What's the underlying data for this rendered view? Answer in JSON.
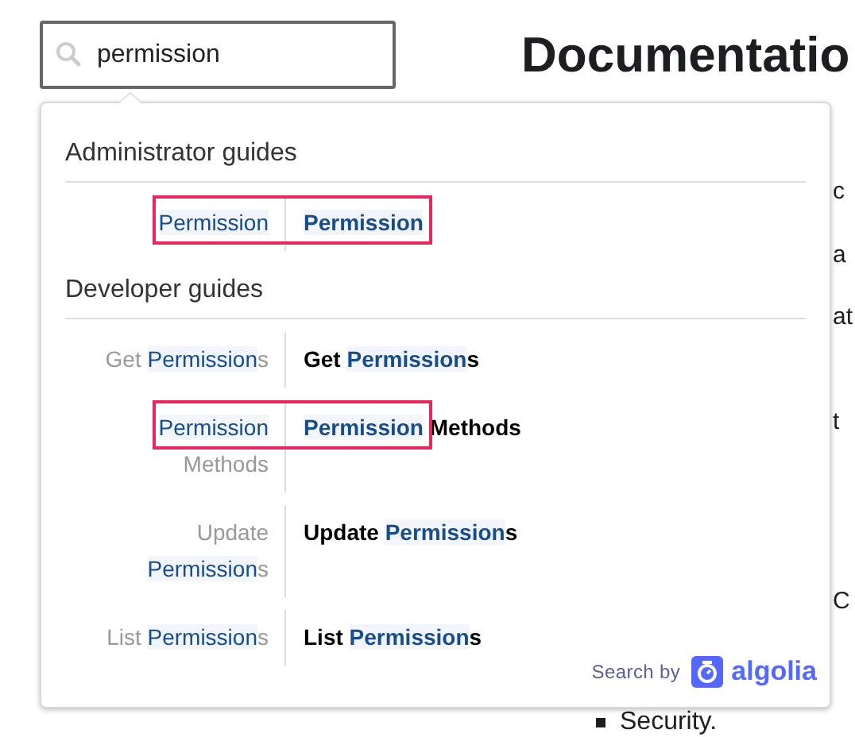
{
  "search": {
    "value": "permission"
  },
  "page": {
    "heading": "Documentatio",
    "fragments": [
      "c",
      "a",
      "at",
      "t",
      "C"
    ],
    "bullet": "Security."
  },
  "dropdown": {
    "sections": [
      {
        "title": "Administrator guides",
        "results": [
          {
            "annotated": true,
            "breadcrumb": [
              {
                "text": "Permission",
                "match": true
              }
            ],
            "title": [
              {
                "text": "Permission",
                "match": true
              }
            ]
          }
        ]
      },
      {
        "title": "Developer guides",
        "results": [
          {
            "annotated": false,
            "breadcrumb": [
              {
                "text": "Get ",
                "match": false
              },
              {
                "text": "Permission",
                "match": true
              },
              {
                "text": "s",
                "match": false
              }
            ],
            "title": [
              {
                "text": "Get ",
                "match": false
              },
              {
                "text": "Permission",
                "match": true
              },
              {
                "text": "s",
                "match": false
              }
            ]
          },
          {
            "annotated": true,
            "breadcrumb": [
              {
                "text": "Permission",
                "match": true
              },
              {
                "text": " Methods",
                "match": false
              }
            ],
            "title": [
              {
                "text": "Permission",
                "match": true
              },
              {
                "text": " Methods",
                "match": false
              }
            ]
          },
          {
            "annotated": false,
            "breadcrumb": [
              {
                "text": "Update ",
                "match": false
              },
              {
                "text": "Permission",
                "match": true
              },
              {
                "text": "s",
                "match": false
              }
            ],
            "title": [
              {
                "text": "Update ",
                "match": false
              },
              {
                "text": "Permission",
                "match": true
              },
              {
                "text": "s",
                "match": false
              }
            ]
          },
          {
            "annotated": false,
            "breadcrumb": [
              {
                "text": "List ",
                "match": false
              },
              {
                "text": "Permission",
                "match": true
              },
              {
                "text": "s",
                "match": false
              }
            ],
            "title": [
              {
                "text": "List ",
                "match": false
              },
              {
                "text": "Permission",
                "match": true
              },
              {
                "text": "s",
                "match": false
              }
            ]
          }
        ]
      }
    ],
    "footer": {
      "label": "Search by",
      "brand": "algolia"
    }
  }
}
